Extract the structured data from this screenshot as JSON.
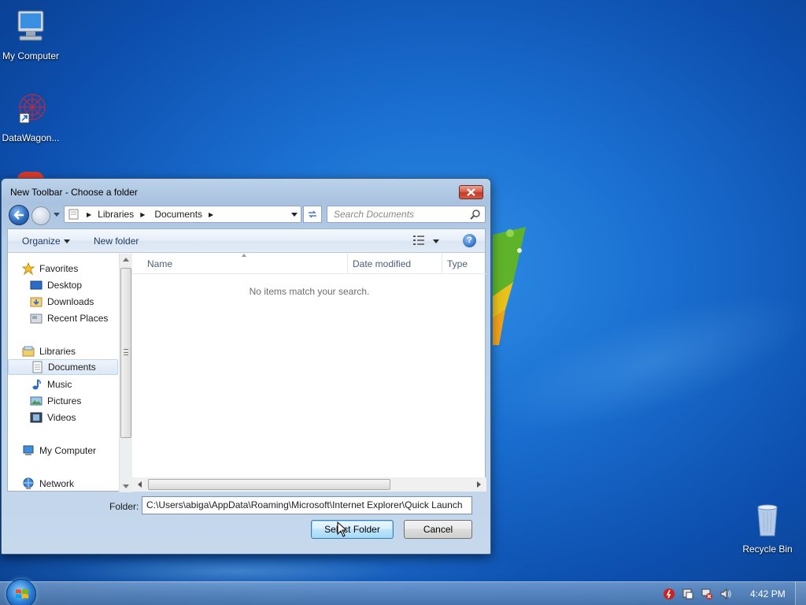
{
  "desktop": {
    "icons": [
      {
        "label": "My Computer"
      },
      {
        "label": "DataWagon..."
      },
      {
        "label": "Recycle Bin"
      }
    ]
  },
  "dialog": {
    "title": "New Toolbar - Choose a folder",
    "address": {
      "crumbs": [
        "Libraries",
        "Documents"
      ]
    },
    "search_placeholder": "Search Documents",
    "command_bar": {
      "organize": "Organize",
      "new_folder": "New folder"
    },
    "nav_pane": {
      "favorites": "Favorites",
      "desktop": "Desktop",
      "downloads": "Downloads",
      "recent_places": "Recent Places",
      "libraries": "Libraries",
      "documents": "Documents",
      "music": "Music",
      "pictures": "Pictures",
      "videos": "Videos",
      "my_computer": "My Computer",
      "network": "Network"
    },
    "columns": {
      "name": "Name",
      "date_modified": "Date modified",
      "type": "Type"
    },
    "empty_message": "No items match your search.",
    "folder_label": "Folder:",
    "folder_value": "C:\\Users\\abiga\\AppData\\Roaming\\Microsoft\\Internet Explorer\\Quick Launch",
    "select_folder_button": "Select Folder",
    "cancel_button": "Cancel"
  },
  "taskbar": {
    "clock": "4:42 PM"
  },
  "colors": {
    "desktop_bg": "#1a6fd0",
    "close_red": "#c23b26",
    "accent_blue": "#3c7fb1"
  }
}
